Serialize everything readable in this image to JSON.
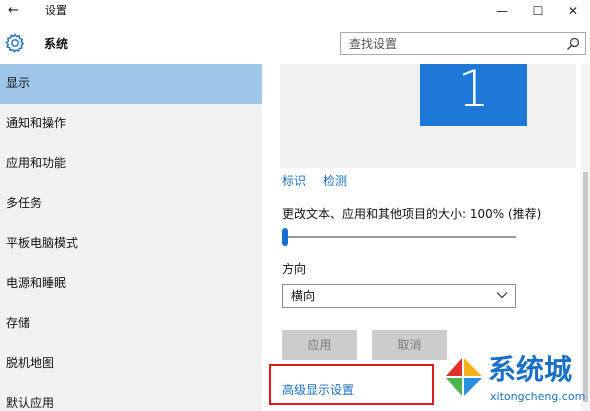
{
  "window": {
    "title": "设置",
    "controls": {
      "minimize": "—",
      "maximize": "☐",
      "close": "✕"
    },
    "back_icon": "←"
  },
  "header": {
    "app_title": "系统",
    "icon": "gear-icon",
    "search": {
      "placeholder": "查找设置",
      "icon": "search-icon"
    }
  },
  "sidebar": {
    "items": [
      {
        "label": "显示",
        "active": true
      },
      {
        "label": "通知和操作",
        "active": false
      },
      {
        "label": "应用和功能",
        "active": false
      },
      {
        "label": "多任务",
        "active": false
      },
      {
        "label": "平板电脑模式",
        "active": false
      },
      {
        "label": "电源和睡眠",
        "active": false
      },
      {
        "label": "存储",
        "active": false
      },
      {
        "label": "脱机地图",
        "active": false
      },
      {
        "label": "默认应用",
        "active": false
      }
    ]
  },
  "display": {
    "monitor_number": "1",
    "identify_link": "标识",
    "detect_link": "检测",
    "scale_label": "更改文本、应用和其他项目的大小: 100% (推荐)",
    "scale_level": 0,
    "orientation_label": "方向",
    "orientation_value": "横向",
    "apply_button": "应用",
    "cancel_button": "取消",
    "advanced_link": "高级显示设置"
  },
  "watermark": {
    "text": "系统城",
    "url": "xitongcheng.com"
  },
  "colors": {
    "accent": "#1e78d7",
    "active_nav": "#9dc6e8",
    "link": "#1a6fc4",
    "highlight_box": "#e01a1a"
  }
}
